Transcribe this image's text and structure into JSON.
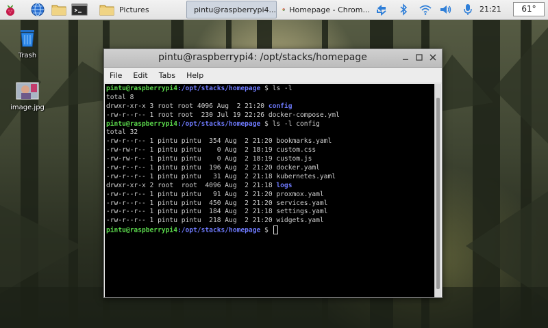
{
  "taskbar": {
    "tasks": [
      {
        "label": "Pictures",
        "icon": "folder-icon"
      },
      {
        "label": "pintu@raspberrypi4...",
        "icon": "terminal-icon",
        "active": true
      },
      {
        "label": "Homepage - Chrom...",
        "icon": "chrome-icon"
      }
    ],
    "clock": "21:21",
    "temperature": "61°"
  },
  "desktop": {
    "icons": [
      {
        "label": "Trash",
        "icon": "trash-icon"
      },
      {
        "label": "image.jpg",
        "icon": "image-file-icon"
      }
    ]
  },
  "window": {
    "title": "pintu@raspberrypi4: /opt/stacks/homepage",
    "menu": [
      "File",
      "Edit",
      "Tabs",
      "Help"
    ],
    "prompt_user": "pintu@raspberrypi4",
    "prompt_path": ":/opt/stacks/homepage",
    "prompt_symbol": " $ ",
    "terminal_lines": [
      {
        "type": "prompt",
        "cmd": "ls -l"
      },
      {
        "type": "text",
        "text": "total 8"
      },
      {
        "type": "dir",
        "text": "drwxr-xr-x 3 root root 4096 Aug  2 21:20 ",
        "name": "config"
      },
      {
        "type": "text",
        "text": "-rw-r--r-- 1 root root  230 Jul 19 22:26 docker-compose.yml"
      },
      {
        "type": "prompt",
        "cmd": "ls -l config"
      },
      {
        "type": "text",
        "text": "total 32"
      },
      {
        "type": "text",
        "text": "-rw-r--r-- 1 pintu pintu  354 Aug  2 21:20 bookmarks.yaml"
      },
      {
        "type": "text",
        "text": "-rw-rw-r-- 1 pintu pintu    0 Aug  2 18:19 custom.css"
      },
      {
        "type": "text",
        "text": "-rw-rw-r-- 1 pintu pintu    0 Aug  2 18:19 custom.js"
      },
      {
        "type": "text",
        "text": "-rw-r--r-- 1 pintu pintu  196 Aug  2 21:20 docker.yaml"
      },
      {
        "type": "text",
        "text": "-rw-r--r-- 1 pintu pintu   31 Aug  2 21:18 kubernetes.yaml"
      },
      {
        "type": "dir",
        "text": "drwxr-xr-x 2 root  root  4096 Aug  2 21:18 ",
        "name": "logs"
      },
      {
        "type": "text",
        "text": "-rw-r--r-- 1 pintu pintu   91 Aug  2 21:20 proxmox.yaml"
      },
      {
        "type": "text",
        "text": "-rw-r--r-- 1 pintu pintu  450 Aug  2 21:20 services.yaml"
      },
      {
        "type": "text",
        "text": "-rw-r--r-- 1 pintu pintu  184 Aug  2 21:18 settings.yaml"
      },
      {
        "type": "text",
        "text": "-rw-r--r-- 1 pintu pintu  218 Aug  2 21:20 widgets.yaml"
      },
      {
        "type": "prompt",
        "cmd": "",
        "cursor": true
      }
    ]
  },
  "colors": {
    "prompt_user": "#5bd94c",
    "prompt_path": "#6f7bff",
    "terminal_bg": "#000000",
    "terminal_fg": "#d0d0d0"
  }
}
